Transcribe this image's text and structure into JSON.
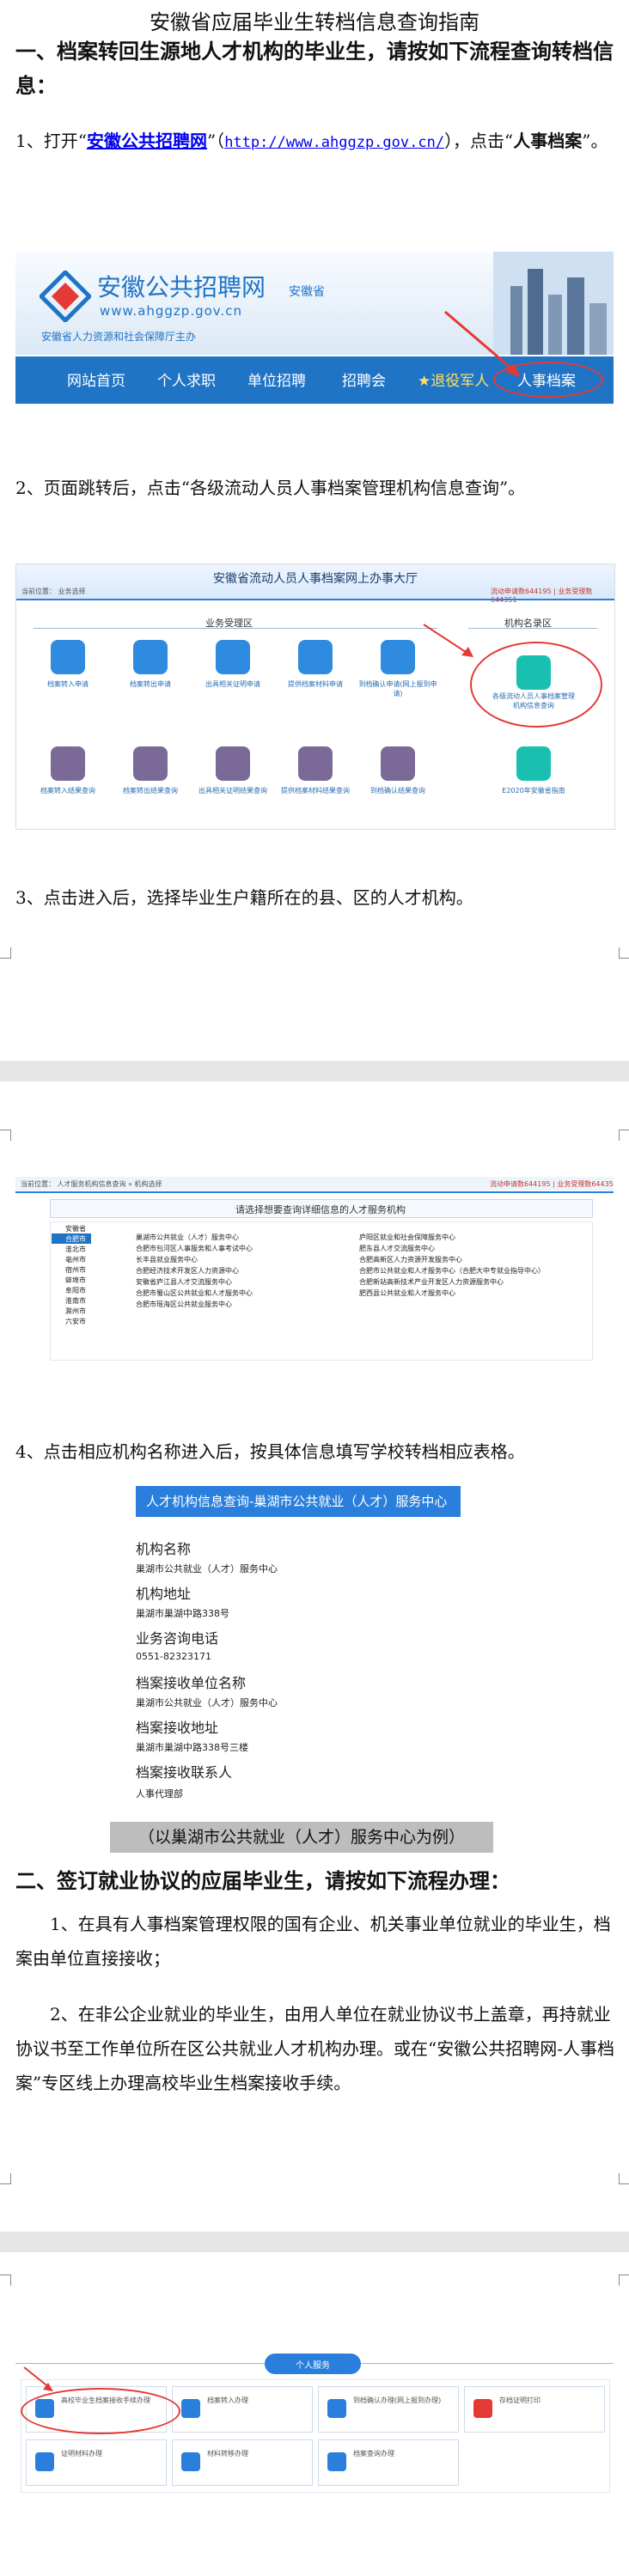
{
  "title": "安徽省应届毕业生转档信息查询指南",
  "section1": {
    "heading": "一、档案转回生源地人才机构的毕业生，请按如下流程查询转档信息：",
    "step1_prefix": "1、打开“",
    "step1_link": "安徽公共招聘网",
    "step1_mid": "”（",
    "step1_url": "http://www.ahggzp.gov.cn/",
    "step1_mid2": "），点击“",
    "step1_bold": "人事档案",
    "step1_suffix": "”。",
    "step2": "2、页面跳转后，点击“各级流动人员人事档案管理机构信息查询”。",
    "step3": "3、点击进入后，选择毕业生户籍所在的县、区的人才机构。",
    "step4": "4、点击相应机构名称进入后，按具体信息填写学校转档相应表格。"
  },
  "shot1": {
    "logo_cn": "安徽公共招聘网",
    "logo_province": "安徽省",
    "logo_url": "www.ahggzp.gov.cn",
    "logo_sub": "安徽省人力资源和社会保障厅主办",
    "nav": [
      "网站首页",
      "个人求职",
      "单位招聘",
      "招聘会",
      "★退役军人",
      "人事档案"
    ]
  },
  "shot2": {
    "header": "安徽省流动人员人事档案网上办事大厅",
    "location": "当前位置：  业务选择",
    "right_info": "流动申请数644195 | 业务受理数644351",
    "section_left": "业务受理区",
    "section_right": "机构名录区",
    "row1": [
      "档案转入申请",
      "档案转出申请",
      "出具相关证明申请",
      "提供档案材料申请",
      "到档确认申请(网上报到申请)"
    ],
    "row2": [
      "档案转入结果查询",
      "档案转出结果查询",
      "出具相关证明结果查询",
      "提供档案材料结果查询",
      "到档确认结果查询"
    ],
    "highlight": "各级流动人员人事档案管理机构信息查询",
    "right_bottom": "E2020年安徽省指南"
  },
  "shot3": {
    "location": "当前位置：  人才服务机构信息查询 » 机构选择",
    "right_info": "流动申请数644195 | 业务受理数644351",
    "header": "请选择想要查询详细信息的人才服务机构",
    "tree": [
      "安徽省",
      "合肥市",
      "淮北市",
      "亳州市",
      "宿州市",
      "蚌埠市",
      "阜阳市",
      "淮南市",
      "滁州市",
      "六安市"
    ],
    "col1": [
      "巢湖市公共就业（人才）服务中心",
      "合肥市包河区人事服务和人事考试中心",
      "长丰县就业服务中心",
      "合肥经济技术开发区人力资源中心",
      "安徽省庐江县人才交流服务中心",
      "合肥市蜀山区公共就业和人才服务中心",
      "合肥市瑶海区公共就业服务中心"
    ],
    "col2": [
      "庐阳区就业和社会保障服务中心",
      "肥东县人才交流服务中心",
      "合肥高新区人力资源开发服务中心",
      "合肥市公共就业和人才服务中心（合肥大中专就业指导中心）",
      "合肥新站高新技术产业开发区人力资源服务中心",
      "肥西县公共就业和人才服务中心"
    ]
  },
  "shot4": {
    "header": "人才机构信息查询-巢湖市公共就业（人才）服务中心",
    "fields": [
      {
        "label": "机构名称",
        "value": "巢湖市公共就业（人才）服务中心"
      },
      {
        "label": "机构地址",
        "value": "巢湖市巢湖中路338号"
      },
      {
        "label": "业务咨询电话",
        "value": "0551-82323171"
      },
      {
        "label": "档案接收单位名称",
        "value": "巢湖市公共就业（人才）服务中心"
      },
      {
        "label": "档案接收地址",
        "value": "巢湖市巢湖中路338号三楼"
      },
      {
        "label": "档案接收联系人",
        "value": "人事代理部"
      }
    ],
    "caption": "（以巢湖市公共就业（人才）服务中心为例）"
  },
  "section2": {
    "heading": "二、签订就业协议的应届毕业生，请按如下流程办理：",
    "p1": "1、在具有人事档案管理权限的国有企业、机关事业单位就业的毕业生，档案由单位直接接收；",
    "p2": "2、在非公企业就业的毕业生，由用人单位在就业协议书上盖章，再持就业协议书至工作单位所在区公共就业人才机构办理。或在“安徽公共招聘网-人事档案”专区线上办理高校毕业生档案接收手续。"
  },
  "shot5": {
    "tab": "个人服务",
    "items": [
      "高校毕业生档案接收手续办理",
      "档案转入办理",
      "到档确认办理(网上报到办理)",
      "存档证明打印",
      "证明材料办理",
      "材料转移办理",
      "档案查询办理"
    ]
  },
  "colors": {
    "nav_blue": "#1f74c6",
    "highlight_red": "#e53935",
    "link_blue": "#0000ee",
    "band_gray": "#e6e6e6"
  }
}
